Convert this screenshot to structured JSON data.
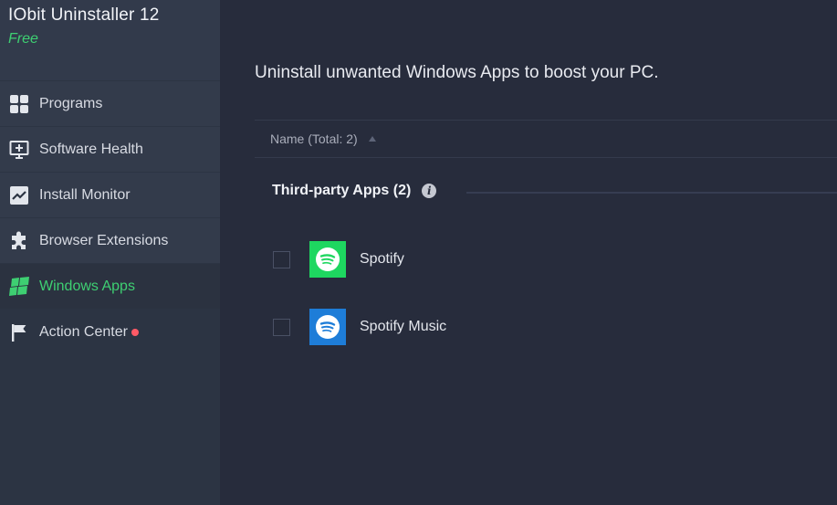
{
  "app": {
    "title": "IObit Uninstaller 12",
    "edition": "Free",
    "accent_color": "#3ecf72"
  },
  "sidebar": {
    "items": [
      {
        "label": "Programs",
        "icon": "grid-icon",
        "active": false
      },
      {
        "label": "Software Health",
        "icon": "plus-monitor-icon",
        "active": false
      },
      {
        "label": "Install Monitor",
        "icon": "chart-line-icon",
        "active": false
      },
      {
        "label": "Browser Extensions",
        "icon": "puzzle-icon",
        "active": false
      },
      {
        "label": "Windows Apps",
        "icon": "windows-logo-icon",
        "active": true
      },
      {
        "label": "Action Center",
        "icon": "flag-icon",
        "active": false,
        "alert": true
      }
    ]
  },
  "main": {
    "headline": "Uninstall unwanted Windows Apps to boost your PC.",
    "column_header": "Name (Total: 2)",
    "group": {
      "title": "Third-party Apps (2)"
    },
    "apps": [
      {
        "name": "Spotify",
        "icon": "spotify-icon",
        "icon_bg": "#1ed760",
        "checked": false
      },
      {
        "name": "Spotify Music",
        "icon": "spotify-music-icon",
        "icon_bg": "#1e7dd8",
        "checked": false
      }
    ]
  }
}
